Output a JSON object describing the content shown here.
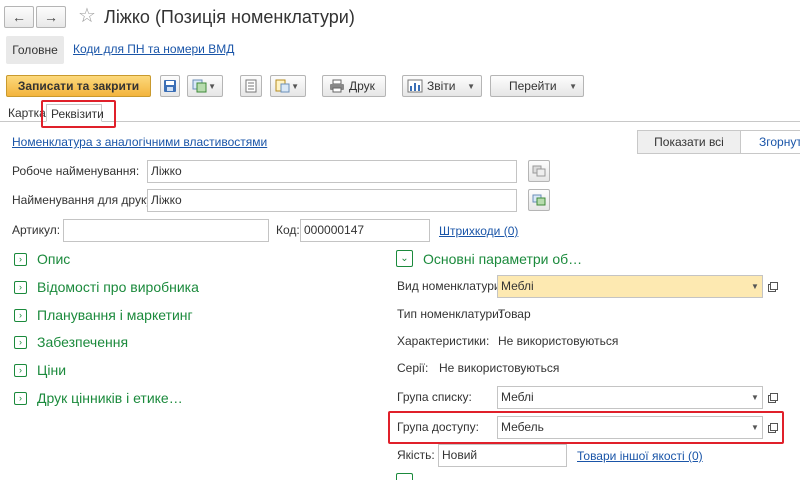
{
  "window": {
    "title": "Ліжко (Позиція номенклатури)"
  },
  "sections": {
    "main": "Головне",
    "codes_link": "Коди для ПН та номери ВМД"
  },
  "toolbar": {
    "save_close": "Записати та закрити",
    "print": "Друк",
    "reports": "Звіти",
    "goto": "Перейти"
  },
  "form_tabs": {
    "card": "Картка",
    "details": "Реквізити"
  },
  "links": {
    "similar": "Номенклатура з аналогічними властивостями",
    "barcodes": "Штрихкоди (0)",
    "other_quality": "Товари іншої якості (0)"
  },
  "view_buttons": {
    "show_all": "Показати всі",
    "collapse": "Згорнути"
  },
  "fields": {
    "work_name_label": "Робоче найменування:",
    "work_name_value": "Ліжко",
    "print_name_label": "Найменування для друку:",
    "print_name_value": "Ліжко",
    "article_label": "Артикул:",
    "article_value": "",
    "code_label": "Код:",
    "code_value": "000000147"
  },
  "groups": [
    "Опис",
    "Відомості про виробника",
    "Планування і маркетинг",
    "Забезпечення",
    "Ціни",
    "Друк цінників і етике…"
  ],
  "main_params": {
    "title": "Основні параметри об…",
    "kind_label": "Вид номенклатури:",
    "kind_value": "Меблі",
    "type_label": "Тип номенклатури:",
    "type_value": "Товар",
    "chars_label": "Характеристики:",
    "chars_value": "Не використовуються",
    "series_label": "Серії:",
    "series_value": "Не використовуються",
    "list_group_label": "Група списку:",
    "list_group_value": "Меблі",
    "access_group_label": "Група доступу:",
    "access_group_value": "Мебель",
    "quality_label": "Якість:",
    "quality_value": "Новий"
  },
  "colors": {
    "accent_green": "#1b8a3c",
    "link_blue": "#1a55a8",
    "highlight_red": "#e0202a",
    "primary_button": "#f3b43d",
    "mandatory_field": "#fde9b1"
  }
}
